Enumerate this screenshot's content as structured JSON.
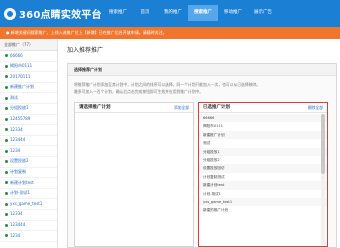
{
  "app": {
    "logo_text": "360点睛实效平台",
    "nav": [
      "搜索推广",
      "首页",
      "我的推广",
      "搜索推广",
      "移动推广",
      "展示广告"
    ],
    "nav_active": 3
  },
  "notice": "● 新增关键词搜索推广，上线入选推广位上【新增】已在推广后台开放申请。请随时关注。",
  "sidebar": {
    "header": "全部推广（77）",
    "items": [
      "66666",
      "揭阳市0111",
      "20170111",
      "新建推广计划",
      "测试",
      "分组投放1",
      "12455789",
      "12334",
      "123444",
      "1234",
      "设置投放2",
      "计划复制",
      "新建计划test",
      "计划-测试1",
      "yxs_game_test1",
      "12334",
      "123444",
      "1234"
    ]
  },
  "main": {
    "title": "加入推荐推广",
    "panel_header": "选择推荐广计划",
    "intro_lines": [
      "将推荐推广计划添加至其计划中，计划之间的排序可以选择。同一个计划只能加入一次，也可以从已选择移除。",
      "最多可加入一百个计划，确认后点击完成按钮即可生效并应用到推广计划中。"
    ],
    "left_box": {
      "title": "请选择推广计划",
      "action": "添加全部",
      "items": []
    },
    "right_box": {
      "title": "已选推广计划",
      "action": "删除全部",
      "items": [
        "66666",
        "揭阳市0111",
        "新建推广计划",
        "测试",
        "分组投放1",
        "分组投放2",
        "设置投放回访",
        "计划复制测试",
        "新建计划test",
        "计划-测试1",
        "yxs_game_test1",
        "新建的推广计划"
      ]
    }
  }
}
